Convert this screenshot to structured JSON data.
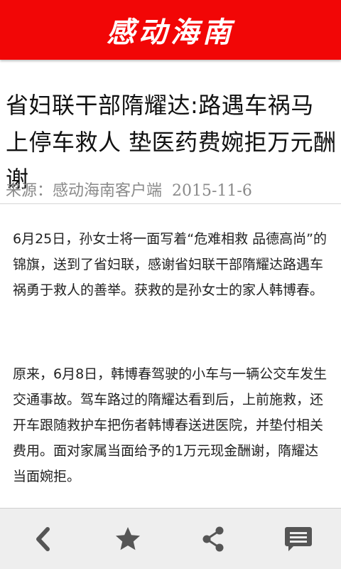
{
  "header": {
    "app_title": "感动海南"
  },
  "article": {
    "title": "省妇联干部隋耀达:路遇车祸马上停车救人 垫医药费婉拒万元酬谢",
    "source_label": "来源：感动海南客户端",
    "date": "2015-11-6",
    "paragraphs": [
      "6月25日，孙女士将一面写着“危难相救 品德高尚”的锦旗，送到了省妇联，感谢省妇联干部隋耀达路遇车祸勇于救人的善举。获救的是孙女士的家人韩博春。",
      "原来，6月8日，韩博春驾驶的小车与一辆公交车发生交通事故。驾车路过的隋耀达看到后，上前施救，还开车跟随救护车把伤者韩博春送进医院，并垫付相关费用。面对家属当面给予的1万元现金酬谢，隋耀达当面婉拒。"
    ]
  },
  "toolbar": {
    "icons": [
      "back-icon",
      "star-icon",
      "share-icon",
      "comment-icon"
    ]
  },
  "colors": {
    "header_bg": "#f20606",
    "header_text": "#ffffff",
    "toolbar_bg": "#eeeeee",
    "icon": "#555555",
    "source_text": "#8a8a8a"
  }
}
